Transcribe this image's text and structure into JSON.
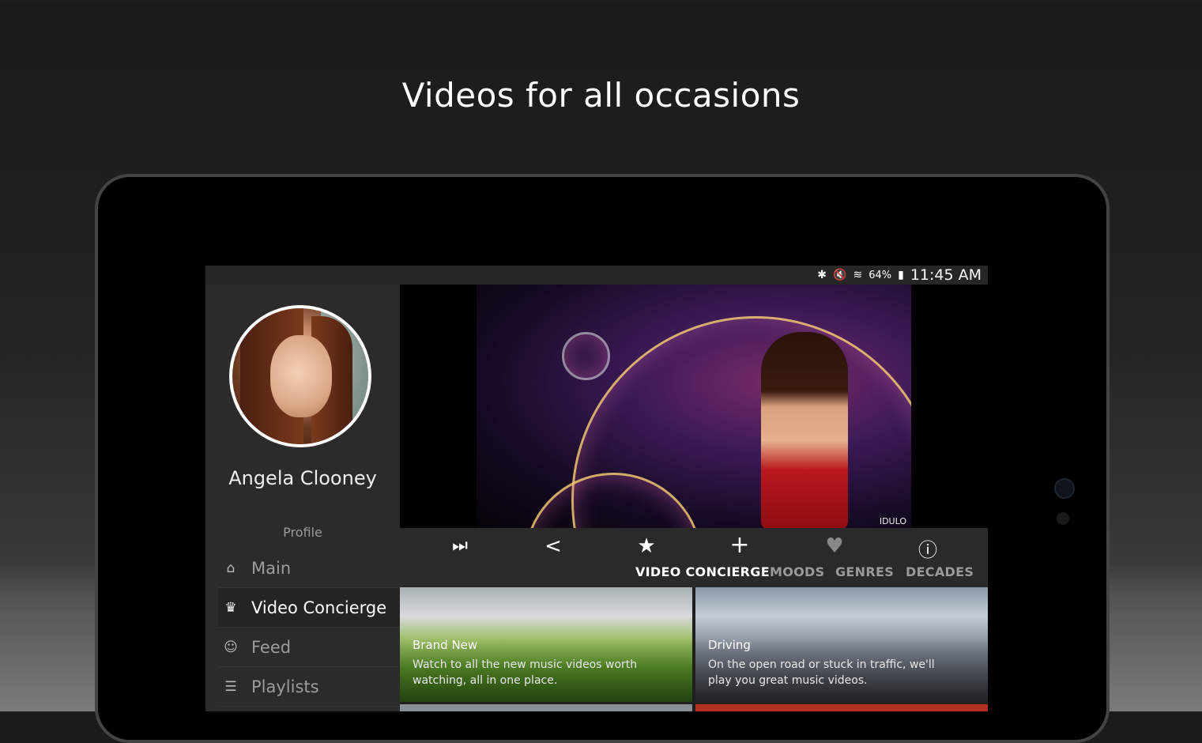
{
  "headline": "Videos for all occasions",
  "status_bar": {
    "icons": [
      "bluetooth-icon",
      "mute-icon",
      "wifi-icon",
      "battery-icon"
    ],
    "battery": "64%",
    "time": "11:45 AM"
  },
  "profile": {
    "name": "Angela Clooney",
    "subtitle": "Profile"
  },
  "nav": {
    "items": [
      {
        "label": "Main",
        "icon": "home-icon",
        "active": false
      },
      {
        "label": "Video Concierge",
        "icon": "concierge-icon",
        "active": true
      },
      {
        "label": "Feed",
        "icon": "feed-icon",
        "active": false
      },
      {
        "label": "Playlists",
        "icon": "playlist-icon",
        "active": false
      }
    ]
  },
  "hero": {
    "logo_text": "IDULO"
  },
  "toolbar": {
    "icons": [
      "skip-next-icon",
      "share-icon",
      "star-icon",
      "plus-icon",
      "heart-icon",
      "info-icon"
    ]
  },
  "tabs": [
    {
      "label": "VIDEO CONCIERGE",
      "active": true
    },
    {
      "label": "MOODS",
      "active": false
    },
    {
      "label": "GENRES",
      "active": false
    },
    {
      "label": "DECADES",
      "active": false
    }
  ],
  "cards": [
    {
      "title": "Brand New",
      "description": "Watch to all the new music videos worth watching, all in one place."
    },
    {
      "title": "Driving",
      "description": "On the open road or stuck in traffic, we'll play you great music videos."
    }
  ],
  "colors": {
    "background": "#1f1f1f",
    "sidebar": "#2b2b2b",
    "accent_text": "#ffffff",
    "muted_text": "#9a9a9a"
  }
}
